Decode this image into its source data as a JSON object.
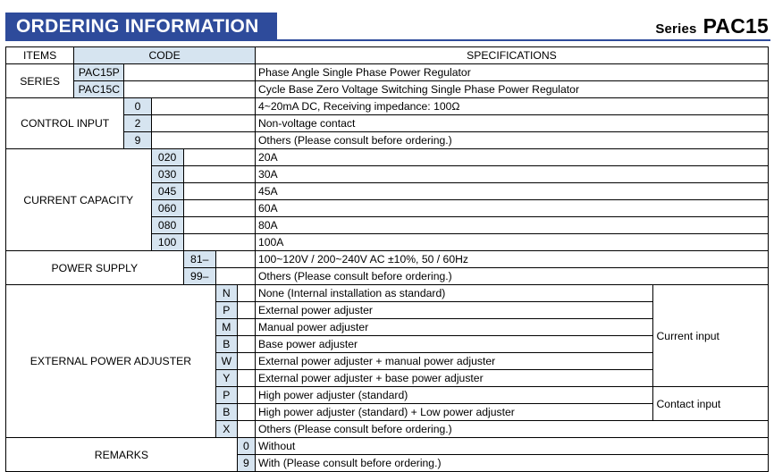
{
  "header": {
    "banner_title": "ORDERING INFORMATION",
    "series_label": "Series",
    "series_model": "PAC15",
    "banner_color": "#2e4b9b",
    "code_cell_color": "#d6e4f0"
  },
  "table": {
    "columns": {
      "items": "ITEMS",
      "code": "CODE",
      "specifications": "SPECIFICATIONS"
    },
    "groups": [
      {
        "name": "SERIES",
        "code_level": 0,
        "rows": [
          {
            "code": "PAC15P",
            "spec": "Phase Angle Single Phase Power Regulator"
          },
          {
            "code": "PAC15C",
            "spec": "Cycle Base Zero Voltage Switching Single Phase Power Regulator"
          }
        ]
      },
      {
        "name": "CONTROL INPUT",
        "code_level": 1,
        "rows": [
          {
            "code": "0",
            "spec": "4~20mA DC, Receiving impedance:  100Ω"
          },
          {
            "code": "2",
            "spec": "Non-voltage contact"
          },
          {
            "code": "9",
            "spec": "Others (Please consult before ordering.)"
          }
        ]
      },
      {
        "name": "CURRENT CAPACITY",
        "code_level": 2,
        "rows": [
          {
            "code": "020",
            "spec": "20A"
          },
          {
            "code": "030",
            "spec": "30A"
          },
          {
            "code": "045",
            "spec": "45A"
          },
          {
            "code": "060",
            "spec": "60A"
          },
          {
            "code": "080",
            "spec": "80A"
          },
          {
            "code": "100",
            "spec": "100A"
          }
        ]
      },
      {
        "name": "POWER SUPPLY",
        "code_level": 3,
        "rows": [
          {
            "code": "81–",
            "spec": "100~120V / 200~240V AC ±10%,  50 / 60Hz"
          },
          {
            "code": "99–",
            "spec": "Others (Please consult before ordering.)"
          }
        ]
      },
      {
        "name": "EXTERNAL POWER ADJUSTER",
        "code_level": 4,
        "rows": [
          {
            "code": "N",
            "spec": "None (Internal installation as standard)"
          },
          {
            "code": "P",
            "spec": "External power adjuster"
          },
          {
            "code": "M",
            "spec": "Manual power adjuster"
          },
          {
            "code": "B",
            "spec": "Base power adjuster"
          },
          {
            "code": "W",
            "spec": "External power adjuster + manual power adjuster"
          },
          {
            "code": "Y",
            "spec": "External power adjuster + base power adjuster"
          },
          {
            "code": "P",
            "spec": "High power adjuster (standard)"
          },
          {
            "code": "B",
            "spec": "High power adjuster (standard) + Low power adjuster"
          },
          {
            "code": "X",
            "spec": "Others (Please consult before ordering.)"
          }
        ],
        "input_type_notes": [
          {
            "label": "Current input",
            "span": 6
          },
          {
            "label": "Contact input",
            "span": 2
          }
        ]
      },
      {
        "name": "REMARKS",
        "code_level": 5,
        "rows": [
          {
            "code": "0",
            "spec": "Without"
          },
          {
            "code": "9",
            "spec": "With (Please consult before ordering.)"
          }
        ]
      }
    ]
  }
}
